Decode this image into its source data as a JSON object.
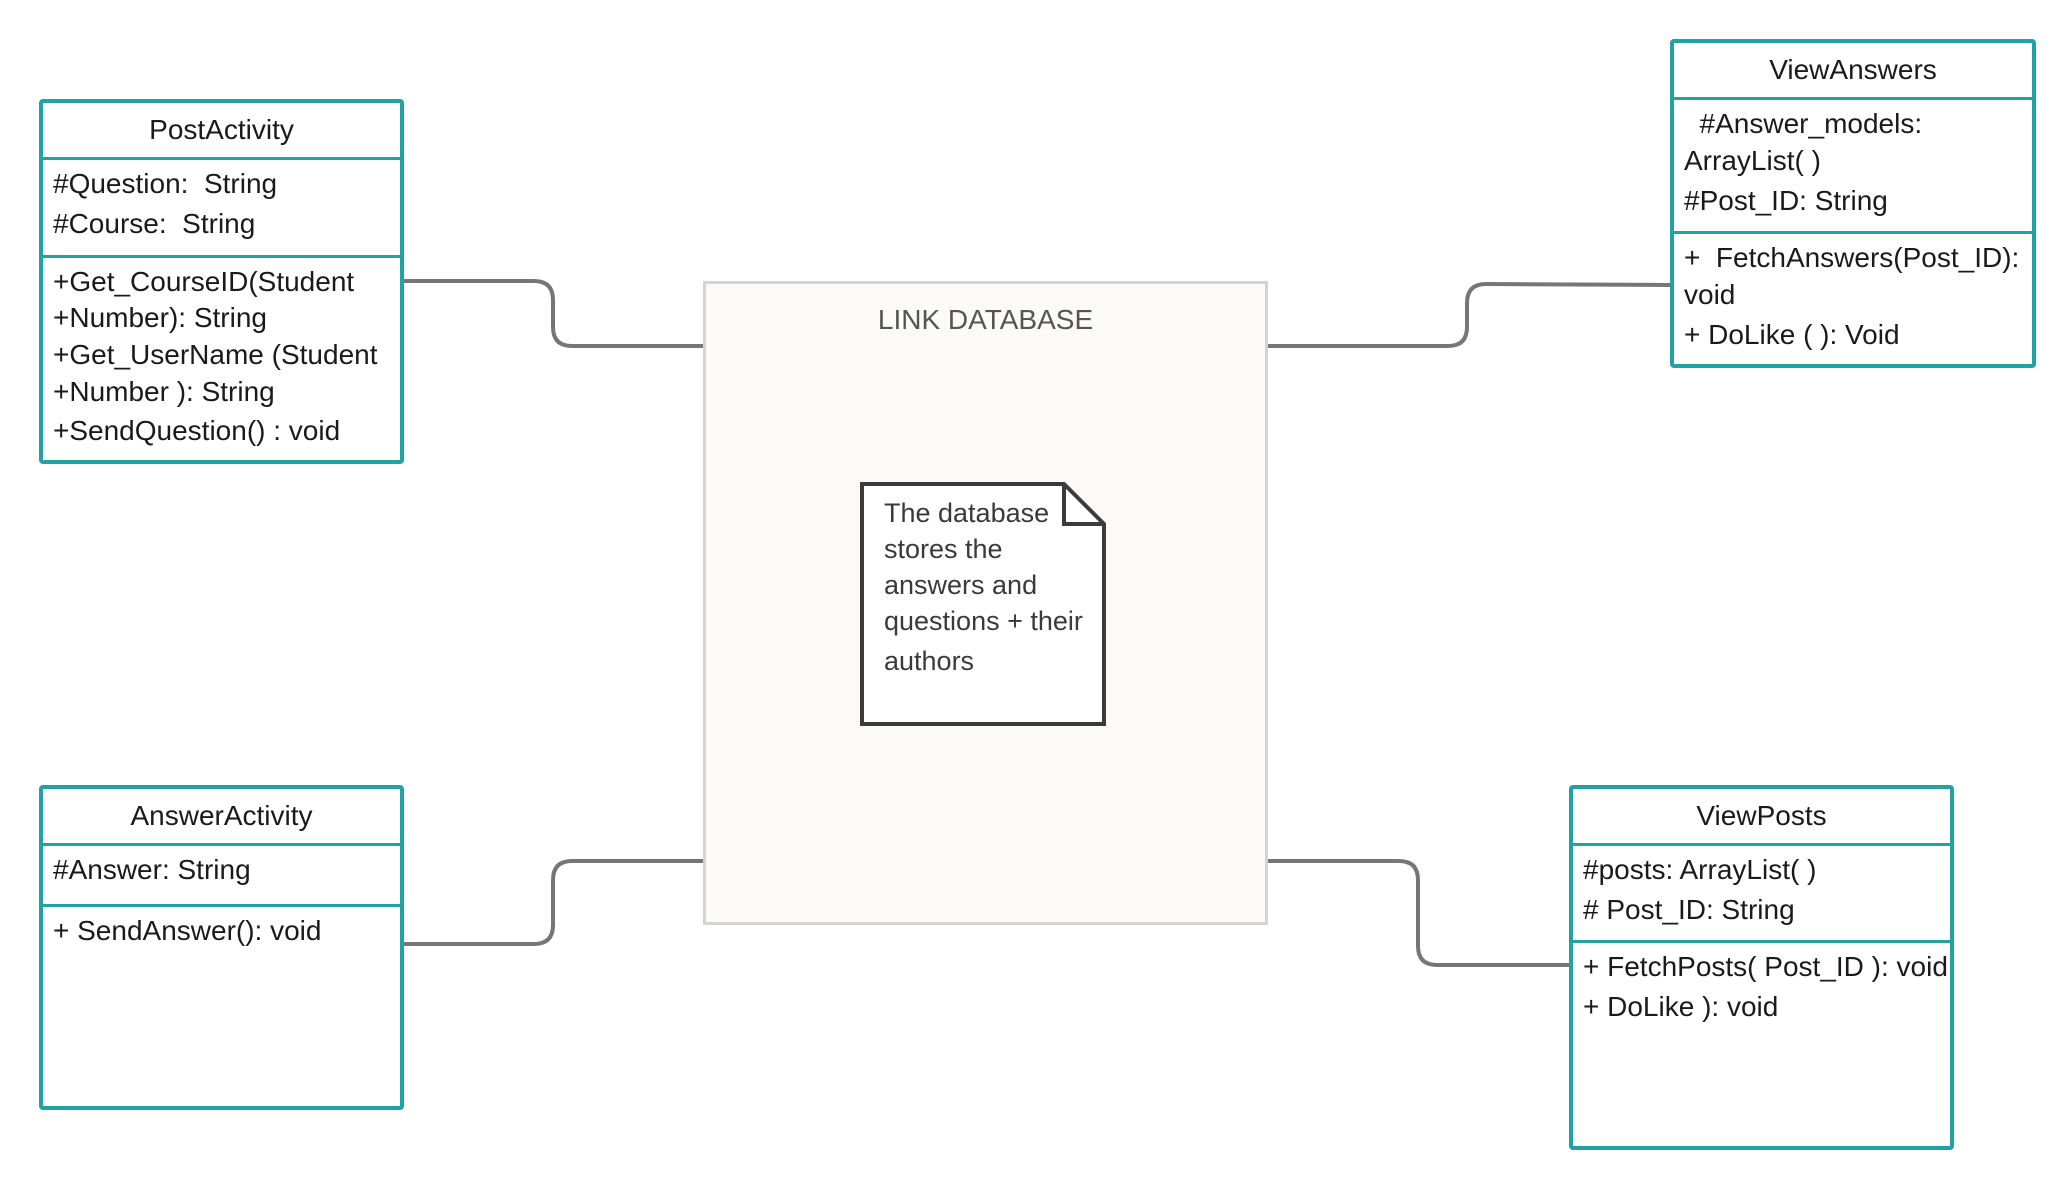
{
  "classes": {
    "post_activity": {
      "name": "PostActivity",
      "attributes": [
        "#Question:  String",
        "#Course:  String"
      ],
      "methods": [
        "+Get_CourseID(Student",
        "+Number): String",
        "+Get_UserName (Student",
        "+Number ): String",
        "+SendQuestion() : void"
      ]
    },
    "answer_activity": {
      "name": "AnswerActivity",
      "attributes": [
        "#Answer: String"
      ],
      "methods": [
        "+ SendAnswer(): void"
      ]
    },
    "view_answers": {
      "name": "ViewAnswers",
      "attributes": [
        "  #Answer_models:",
        "ArrayList( )",
        "#Post_ID: String"
      ],
      "methods": [
        "+  FetchAnswers(Post_ID):",
        "void",
        "+ DoLike ( ): Void"
      ]
    },
    "view_posts": {
      "name": "ViewPosts",
      "attributes": [
        "#posts: ArrayList( )",
        "# Post_ID: String"
      ],
      "methods": [
        "+ FetchPosts( Post_ID ): void",
        "+ DoLike ): void"
      ]
    }
  },
  "database": {
    "title": "LINK DATABASE",
    "note_lines": [
      "The database",
      "stores the",
      "answers and",
      "questions + their",
      "authors"
    ]
  },
  "colors": {
    "class_border": "#21a2a5",
    "connector": "#767676",
    "database_border": "#d4d4d4",
    "database_fill": "#fbfaf8",
    "note_border": "#3c3c3c"
  }
}
